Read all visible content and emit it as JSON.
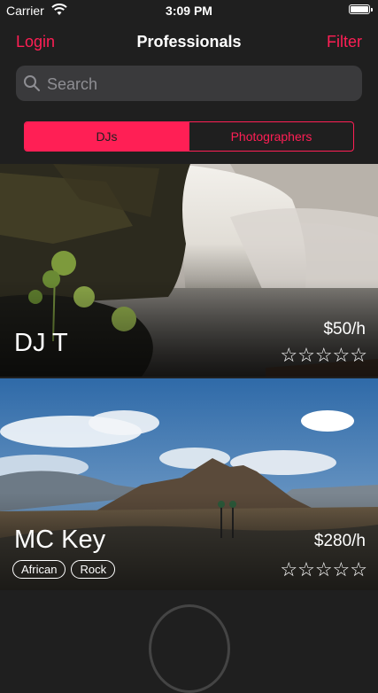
{
  "status_bar": {
    "carrier": "Carrier",
    "time": "3:09 PM"
  },
  "nav": {
    "left_label": "Login",
    "title": "Professionals",
    "right_label": "Filter"
  },
  "search": {
    "placeholder": "Search"
  },
  "segments": [
    "DJs",
    "Photographers"
  ],
  "colors": {
    "accent": "#ff1f55",
    "background": "#1f1f1f"
  },
  "cards": [
    {
      "name": "DJ T",
      "price": "$50/h",
      "rating": 0,
      "max_rating": 5,
      "stars_display": "☆☆☆☆☆",
      "image": "waterfall",
      "tags": []
    },
    {
      "name": "MC Key",
      "price": "$280/h",
      "rating": 0,
      "max_rating": 5,
      "stars_display": "☆☆☆☆☆",
      "image": "desert-mountains",
      "tags": [
        "African",
        "Rock"
      ]
    }
  ]
}
